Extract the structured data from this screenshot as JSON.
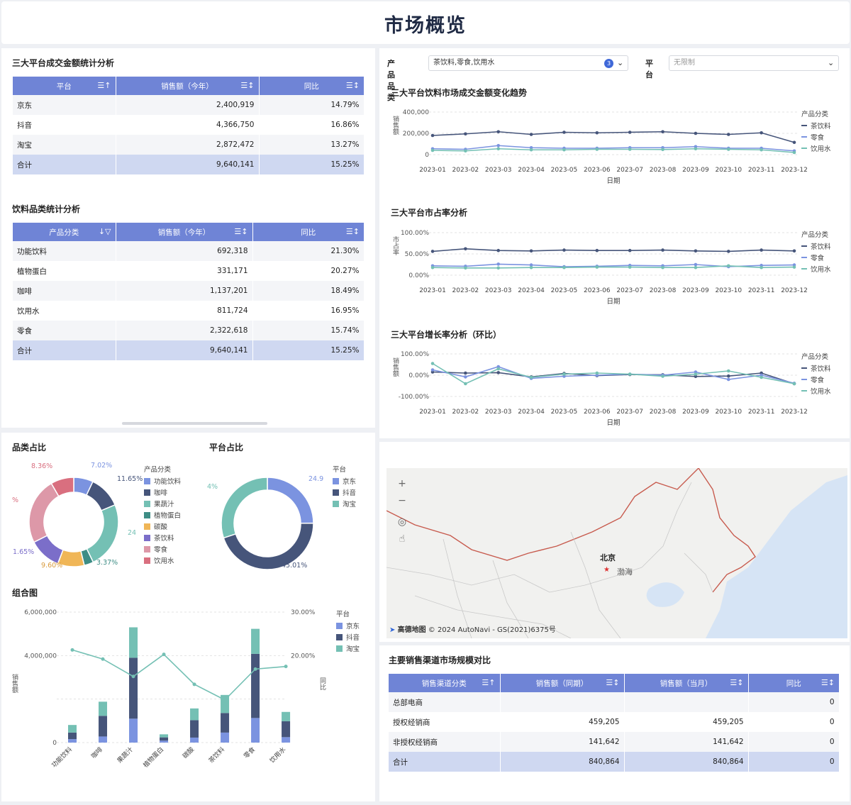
{
  "page_title": "市场概览",
  "platform_table": {
    "title": "三大平台成交金额统计分析",
    "headers": [
      "平台",
      "销售额（今年）",
      "同比"
    ],
    "rows": [
      [
        "京东",
        "2,400,919",
        "14.79%"
      ],
      [
        "抖音",
        "4,366,750",
        "16.86%"
      ],
      [
        "淘宝",
        "2,872,472",
        "13.27%"
      ],
      [
        "合计",
        "9,640,141",
        "15.25%"
      ]
    ]
  },
  "category_table": {
    "title": "饮料品类统计分析",
    "headers": [
      "产品分类",
      "销售额（今年）",
      "同比"
    ],
    "rows": [
      [
        "功能饮料",
        "692,318",
        "21.30%"
      ],
      [
        "植物蛋白",
        "331,171",
        "20.27%"
      ],
      [
        "咖啡",
        "1,137,201",
        "18.49%"
      ],
      [
        "饮用水",
        "811,724",
        "16.95%"
      ],
      [
        "零食",
        "2,322,618",
        "15.74%"
      ],
      [
        "合计",
        "9,640,141",
        "15.25%"
      ]
    ]
  },
  "filters": {
    "product_label": "产品品类",
    "product_value": "茶饮料,零食,饮用水",
    "product_count": "3",
    "platform_label": "平台",
    "platform_value": "无限制"
  },
  "colors": {
    "header_blue": "#6f84d6",
    "jd": "#7b93e0",
    "douyin": "#46557a",
    "taobao": "#74c0b4",
    "tea": "#46557a",
    "snack": "#7b93e0",
    "water": "#74c0b4"
  },
  "line_legend": {
    "title": "产品分类",
    "items": [
      "茶饮料",
      "零食",
      "饮用水"
    ]
  },
  "chart_data": [
    {
      "type": "line",
      "title": "三大平台饮料市场成交金额变化趋势",
      "xlabel": "日期",
      "ylabel": "销售额",
      "x": [
        "2023-01",
        "2023-02",
        "2023-03",
        "2023-04",
        "2023-05",
        "2023-06",
        "2023-07",
        "2023-08",
        "2023-09",
        "2023-10",
        "2023-11",
        "2023-12"
      ],
      "ylim": [
        0,
        400000
      ],
      "yticks": [
        "400,000",
        "200,000",
        "0"
      ],
      "series": [
        {
          "name": "茶饮料",
          "values": [
            180000,
            195000,
            215000,
            190000,
            210000,
            205000,
            210000,
            215000,
            200000,
            190000,
            205000,
            115000
          ]
        },
        {
          "name": "零食",
          "values": [
            55000,
            50000,
            85000,
            65000,
            60000,
            60000,
            65000,
            65000,
            75000,
            60000,
            60000,
            35000
          ]
        },
        {
          "name": "饮用水",
          "values": [
            40000,
            35000,
            55000,
            45000,
            45000,
            50000,
            50000,
            48000,
            55000,
            50000,
            45000,
            20000
          ]
        }
      ]
    },
    {
      "type": "line",
      "title": "三大平台市占率分析",
      "xlabel": "日期",
      "ylabel": "市占率",
      "x": [
        "2023-01",
        "2023-02",
        "2023-03",
        "2023-04",
        "2023-05",
        "2023-06",
        "2023-07",
        "2023-08",
        "2023-09",
        "2023-10",
        "2023-11",
        "2023-12"
      ],
      "ylim": [
        0,
        100
      ],
      "yticks": [
        "100.00%",
        "50.00%",
        "0.00%"
      ],
      "series": [
        {
          "name": "茶饮料",
          "values": [
            56,
            62,
            58,
            57,
            59,
            58,
            58,
            59,
            57,
            56,
            59,
            57
          ]
        },
        {
          "name": "零食",
          "values": [
            22,
            21,
            26,
            24,
            20,
            21,
            23,
            22,
            25,
            20,
            23,
            24
          ]
        },
        {
          "name": "饮用水",
          "values": [
            18,
            17,
            17,
            18,
            18,
            19,
            19,
            18,
            18,
            22,
            18,
            19
          ]
        }
      ]
    },
    {
      "type": "line",
      "title": "三大平台增长率分析（环比）",
      "xlabel": "日期",
      "ylabel": "销售额",
      "x": [
        "2023-01",
        "2023-02",
        "2023-03",
        "2023-04",
        "2023-05",
        "2023-06",
        "2023-07",
        "2023-08",
        "2023-09",
        "2023-10",
        "2023-11",
        "2023-12"
      ],
      "ylim": [
        -100,
        100
      ],
      "yticks": [
        "100.00%",
        "0.00%",
        "-100.00%"
      ],
      "series": [
        {
          "name": "茶饮料",
          "values": [
            15,
            10,
            12,
            -8,
            8,
            -2,
            3,
            2,
            -6,
            -4,
            10,
            -40
          ]
        },
        {
          "name": "零食",
          "values": [
            25,
            -8,
            40,
            -15,
            -5,
            0,
            5,
            0,
            15,
            -20,
            0,
            -38
          ]
        },
        {
          "name": "饮用水",
          "values": [
            55,
            -40,
            30,
            -10,
            5,
            10,
            5,
            -5,
            5,
            20,
            -10,
            -40
          ]
        }
      ]
    },
    {
      "type": "pie",
      "title": "品类占比",
      "legend_title": "产品分类",
      "labels": [
        "功能饮料",
        "咖啡",
        "果蔬汁",
        "植物蛋白",
        "碳酸",
        "茶饮料",
        "零食",
        "饮用水"
      ],
      "values": [
        7.02,
        11.65,
        24,
        3.37,
        9.6,
        11.65,
        24,
        8.36
      ],
      "colors": [
        "#7b93e0",
        "#46557a",
        "#74c0b4",
        "#3e8d85",
        "#f0b657",
        "#7b6ec9",
        "#dd98a8",
        "#d96f7f"
      ],
      "label_text": [
        "7.02%",
        "11.65%",
        "24",
        "3.37%",
        "9.60%",
        "1.65%",
        "%",
        "8.36%"
      ]
    },
    {
      "type": "pie",
      "title": "平台占比",
      "legend_title": "平台",
      "labels": [
        "京东",
        "抖音",
        "淘宝"
      ],
      "values": [
        24.9,
        45.01,
        30.09
      ],
      "colors": [
        "#7b93e0",
        "#46557a",
        "#74c0b4"
      ],
      "label_text": [
        "24.9",
        "45.01%",
        "4%"
      ]
    },
    {
      "type": "bar",
      "title": "组合图",
      "legend_title": "平台",
      "ylabel": "销售额",
      "y2label": "同比",
      "categories": [
        "功能饮料",
        "咖啡",
        "果蔬汁",
        "植物蛋白",
        "碳酸",
        "茶饮料",
        "零食",
        "饮用水"
      ],
      "ylim": [
        0,
        6000000
      ],
      "yticks": [
        "6,000,000",
        "4,000,000",
        "0"
      ],
      "y2lim": [
        0,
        30
      ],
      "y2ticks": [
        "30.00%",
        "20.00%"
      ],
      "series": [
        {
          "name": "京东",
          "values": [
            160000,
            280000,
            1100000,
            90000,
            230000,
            460000,
            1130000,
            250000
          ]
        },
        {
          "name": "抖音",
          "values": [
            300000,
            950000,
            2800000,
            150000,
            800000,
            900000,
            2950000,
            730000
          ]
        },
        {
          "name": "淘宝",
          "values": [
            350000,
            650000,
            1400000,
            140000,
            540000,
            830000,
            1150000,
            430000
          ]
        }
      ],
      "line": {
        "name": "同比",
        "values": [
          21.3,
          19.2,
          15.2,
          20.27,
          13.4,
          9.8,
          16.9,
          17.5
        ]
      }
    }
  ],
  "map": {
    "city": "北京",
    "sea": "渤海",
    "attribution_brand": "高德地图",
    "attribution": "© 2024 AutoNavi - GS(2021)6375号"
  },
  "channel_table": {
    "title": "主要销售渠道市场规模对比",
    "headers": [
      "销售渠道分类",
      "销售额（同期）",
      "销售额（当月）",
      "同比"
    ],
    "rows": [
      [
        "总部电商",
        "",
        "",
        "0"
      ],
      [
        "授权经销商",
        "459,205",
        "459,205",
        "0"
      ],
      [
        "非授权经销商",
        "141,642",
        "141,642",
        "0"
      ],
      [
        "合计",
        "840,864",
        "840,864",
        "0"
      ]
    ]
  }
}
